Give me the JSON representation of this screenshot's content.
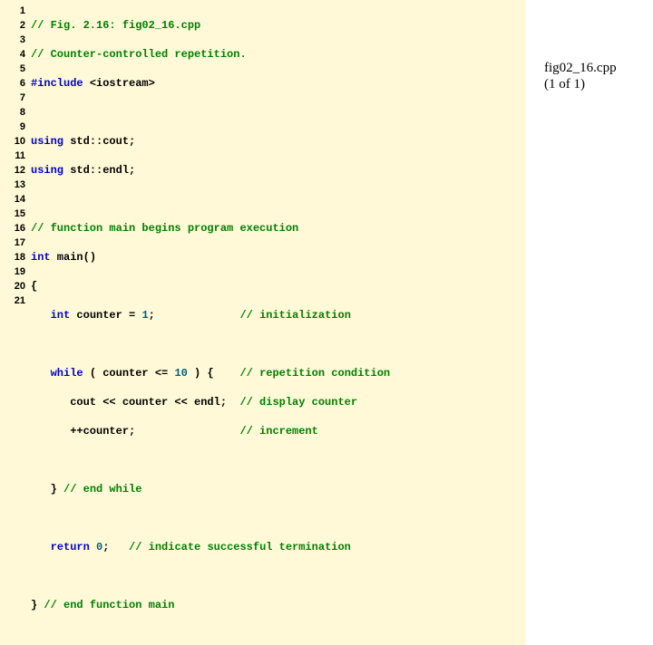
{
  "filename_label": "fig02_16.cpp",
  "page_label": "(1 of 1)",
  "gutter": [
    "1",
    "2",
    "3",
    "4",
    "5",
    "6",
    "7",
    "8",
    "9",
    "10",
    "11",
    "12",
    "13",
    "14",
    "15",
    "16",
    "17",
    "18",
    "19",
    "20",
    "21"
  ],
  "code": {
    "l1": "// Fig. 2.16: fig02_16.cpp",
    "l2": "// Counter-controlled repetition.",
    "l3a": "#include ",
    "l3b": "<iostream>",
    "l5a": "using ",
    "l5b": "std::cout;",
    "l6a": "using ",
    "l6b": "std::endl;",
    "l8": "// function main begins program execution",
    "l9a": "int",
    "l9b": " main()",
    "l10": "{",
    "l11a": "   ",
    "l11b": "int",
    "l11c": " counter = ",
    "l11d": "1",
    "l11e": ";             ",
    "l11f": "// initialization",
    "l13a": "   ",
    "l13b": "while",
    "l13c": " ( counter <= ",
    "l13d": "10",
    "l13e": " ) {    ",
    "l13f": "// repetition condition",
    "l14a": "      cout << counter << endl;  ",
    "l14b": "// display counter",
    "l15a": "      ++counter;                ",
    "l15b": "// increment",
    "l17a": "   } ",
    "l17b": "// end while",
    "l19a": "   ",
    "l19b": "return",
    "l19c": " ",
    "l19d": "0",
    "l19e": ";   ",
    "l19f": "// indicate successful termination",
    "l21a": "} ",
    "l21b": "// end function main"
  }
}
